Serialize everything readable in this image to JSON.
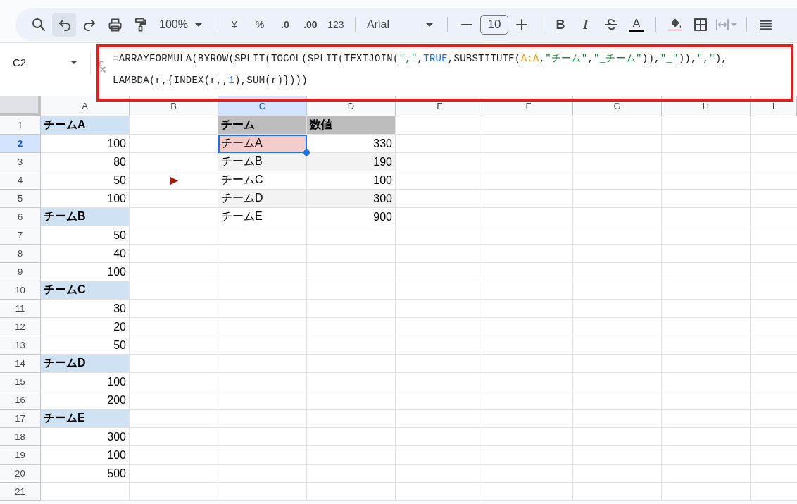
{
  "toolbar": {
    "undo_highlighted": true,
    "zoom": "100%",
    "currency": "¥",
    "percent": "%",
    "decrease_decimal": ".0",
    "increase_decimal": ".00",
    "number_format": "123",
    "font": "Arial",
    "font_size": "10",
    "bold": "B",
    "italic": "I",
    "text_color": "A",
    "merge_disabled": true
  },
  "name_box": "C2",
  "formula": {
    "lines": [
      [
        {
          "kind": "plain",
          "text": "=ARRAYFORMULA(BYROW(SPLIT(TOCOL(SPLIT(TEXTJOIN("
        },
        {
          "kind": "string",
          "text": "\",\""
        },
        {
          "kind": "plain",
          "text": ","
        },
        {
          "kind": "bool",
          "text": "TRUE"
        },
        {
          "kind": "plain",
          "text": ",SUBSTITUTE("
        },
        {
          "kind": "range",
          "text": "A:A"
        },
        {
          "kind": "plain",
          "text": ","
        },
        {
          "kind": "string",
          "text": "\"チーム\""
        },
        {
          "kind": "plain",
          "text": ","
        },
        {
          "kind": "string",
          "text": "\"_チーム\""
        },
        {
          "kind": "plain",
          "text": ")),"
        },
        {
          "kind": "string",
          "text": "\"_\""
        },
        {
          "kind": "plain",
          "text": ")),"
        },
        {
          "kind": "string",
          "text": "\",\""
        },
        {
          "kind": "plain",
          "text": "),"
        }
      ],
      [
        {
          "kind": "plain",
          "text": "LAMBDA(r,{INDEX(r,,"
        },
        {
          "kind": "number",
          "text": "1"
        },
        {
          "kind": "plain",
          "text": "),SUM(r)})))"
        }
      ]
    ],
    "highlighted": true
  },
  "columns": [
    {
      "label": "A",
      "selected": false
    },
    {
      "label": "B",
      "selected": false
    },
    {
      "label": "C",
      "selected": true
    },
    {
      "label": "D",
      "selected": false
    },
    {
      "label": "E",
      "selected": false
    },
    {
      "label": "F",
      "selected": false
    },
    {
      "label": "G",
      "selected": false
    },
    {
      "label": "H",
      "selected": false
    },
    {
      "label": "I",
      "selected": false
    }
  ],
  "rows": [
    {
      "label": "1",
      "selected": false,
      "cells": [
        {
          "kind": "text",
          "text": "チームA",
          "bold": true,
          "color": "#cfe2f3",
          "selected": false
        },
        null,
        {
          "kind": "text",
          "text": "チーム",
          "bold": true,
          "color": "#bdbdbd",
          "selected": false
        },
        {
          "kind": "text",
          "text": "数値",
          "bold": true,
          "color": "#bdbdbd",
          "selected": false
        }
      ]
    },
    {
      "label": "2",
      "selected": true,
      "cells": [
        {
          "kind": "number",
          "text": "100",
          "selected": false
        },
        null,
        {
          "kind": "text",
          "text": "チームA",
          "color": "#f4cccc",
          "selected": true
        },
        {
          "kind": "number",
          "text": "330",
          "selected": false
        }
      ]
    },
    {
      "label": "3",
      "selected": false,
      "cells": [
        {
          "kind": "number",
          "text": "80",
          "selected": false
        },
        null,
        {
          "kind": "text",
          "text": "チームB",
          "color": "#f3f3f3",
          "selected": false
        },
        {
          "kind": "number",
          "text": "190",
          "color": "#f3f3f3",
          "selected": false
        }
      ]
    },
    {
      "label": "4",
      "selected": false,
      "cells": [
        {
          "kind": "number",
          "text": "50",
          "selected": false
        },
        {
          "kind": "marker",
          "selected": false
        },
        {
          "kind": "text",
          "text": "チームC",
          "selected": false
        },
        {
          "kind": "number",
          "text": "100",
          "selected": false
        }
      ]
    },
    {
      "label": "5",
      "selected": false,
      "cells": [
        {
          "kind": "number",
          "text": "100",
          "selected": false
        },
        null,
        {
          "kind": "text",
          "text": "チームD",
          "color": "#f3f3f3",
          "selected": false
        },
        {
          "kind": "number",
          "text": "300",
          "color": "#f3f3f3",
          "selected": false
        }
      ]
    },
    {
      "label": "6",
      "selected": false,
      "cells": [
        {
          "kind": "text",
          "text": "チームB",
          "bold": true,
          "color": "#cfe2f3",
          "selected": false
        },
        null,
        {
          "kind": "text",
          "text": "チームE",
          "selected": false
        },
        {
          "kind": "number",
          "text": "900",
          "selected": false
        }
      ]
    },
    {
      "label": "7",
      "selected": false,
      "cells": [
        {
          "kind": "number",
          "text": "50",
          "selected": false
        }
      ]
    },
    {
      "label": "8",
      "selected": false,
      "cells": [
        {
          "kind": "number",
          "text": "40",
          "selected": false
        }
      ]
    },
    {
      "label": "9",
      "selected": false,
      "cells": [
        {
          "kind": "number",
          "text": "100",
          "selected": false
        }
      ]
    },
    {
      "label": "10",
      "selected": false,
      "cells": [
        {
          "kind": "text",
          "text": "チームC",
          "bold": true,
          "color": "#cfe2f3",
          "selected": false
        }
      ]
    },
    {
      "label": "11",
      "selected": false,
      "cells": [
        {
          "kind": "number",
          "text": "30",
          "selected": false
        }
      ]
    },
    {
      "label": "12",
      "selected": false,
      "cells": [
        {
          "kind": "number",
          "text": "20",
          "selected": false
        }
      ]
    },
    {
      "label": "13",
      "selected": false,
      "cells": [
        {
          "kind": "number",
          "text": "50",
          "selected": false
        }
      ]
    },
    {
      "label": "14",
      "selected": false,
      "cells": [
        {
          "kind": "text",
          "text": "チームD",
          "bold": true,
          "color": "#cfe2f3",
          "selected": false
        }
      ]
    },
    {
      "label": "15",
      "selected": false,
      "cells": [
        {
          "kind": "number",
          "text": "100",
          "selected": false
        }
      ]
    },
    {
      "label": "16",
      "selected": false,
      "cells": [
        {
          "kind": "number",
          "text": "200",
          "selected": false
        }
      ]
    },
    {
      "label": "17",
      "selected": false,
      "cells": [
        {
          "kind": "text",
          "text": "チームE",
          "bold": true,
          "color": "#cfe2f3",
          "selected": false
        }
      ]
    },
    {
      "label": "18",
      "selected": false,
      "cells": [
        {
          "kind": "number",
          "text": "300",
          "selected": false
        }
      ]
    },
    {
      "label": "19",
      "selected": false,
      "cells": [
        {
          "kind": "number",
          "text": "100",
          "selected": false
        }
      ]
    },
    {
      "label": "20",
      "selected": false,
      "cells": [
        {
          "kind": "number",
          "text": "500",
          "selected": false
        }
      ]
    },
    {
      "label": "21",
      "selected": false,
      "cells": []
    }
  ]
}
